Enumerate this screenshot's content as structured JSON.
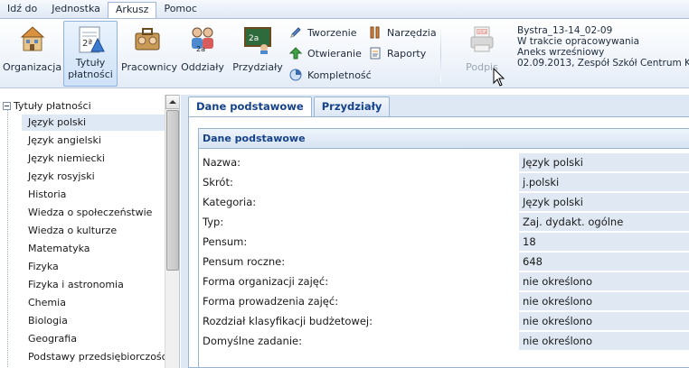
{
  "menu": {
    "items": [
      {
        "label": "Idź do"
      },
      {
        "label": "Jednostka"
      },
      {
        "label": "Arkusz"
      },
      {
        "label": "Pomoc"
      }
    ]
  },
  "ribbon": {
    "organizacja": "Organizacja",
    "tytuly_line1": "Tytuły",
    "tytuly_line2": "płatności",
    "pracownicy": "Pracownicy",
    "oddzialy": "Oddziały",
    "przydzialy": "Przydziały",
    "tworzenie": "Tworzenie",
    "otwieranie": "Otwieranie",
    "kompletnosc": "Kompletność",
    "narzedzia": "Narzędzia",
    "raporty": "Raporty",
    "podpis": "Podpis",
    "pdf_badge": "PDF"
  },
  "info": {
    "line1": "Bystra_13-14_02-09",
    "line2": "W trakcie opracowywania",
    "line3": "Aneks wrześniowy",
    "line4": "02.09.2013, Zespół Szkół Centrum Kszt"
  },
  "tree": {
    "root": "Tytuły płatności",
    "items": [
      "Język polski",
      "Język angielski",
      "Język niemiecki",
      "Język rosyjski",
      "Historia",
      "Wiedza o społeczeństwie",
      "Wiedza o kulturze",
      "Matematyka",
      "Fizyka",
      "Fizyka i astronomia",
      "Chemia",
      "Biologia",
      "Geografia",
      "Podstawy przedsiębiorczości"
    ]
  },
  "tabs": {
    "dane": "Dane podstawowe",
    "przydzialy": "Przydziały"
  },
  "section": {
    "title": "Dane podstawowe",
    "fields": [
      {
        "label": "Nazwa:",
        "value": "Język polski"
      },
      {
        "label": "Skrót:",
        "value": "j.polski"
      },
      {
        "label": "Kategoria:",
        "value": "Język polski"
      },
      {
        "label": "Typ:",
        "value": "Zaj. dydakt. ogólne"
      },
      {
        "label": "Pensum:",
        "value": "18"
      },
      {
        "label": "Pensum roczne:",
        "value": "648"
      },
      {
        "label": "Forma organizacji zajęć:",
        "value": "nie określono"
      },
      {
        "label": "Forma prowadzenia zajęć:",
        "value": "nie określono"
      },
      {
        "label": "Rozdział klasyfikacji budżetowej:",
        "value": "nie określono"
      },
      {
        "label": "Domyślne zadanie:",
        "value": "nie określono"
      }
    ]
  },
  "colors": {
    "accent": "#15428b",
    "panel_bg": "#dde8f4",
    "value_bg": "#dfe8f3"
  }
}
